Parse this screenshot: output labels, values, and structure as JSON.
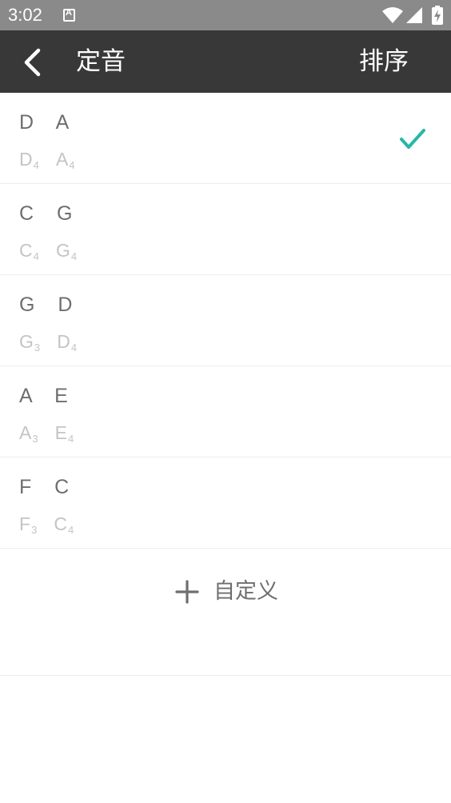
{
  "status_bar": {
    "time": "3:02",
    "icons": [
      "notification-a-icon",
      "wifi-icon",
      "signal-icon",
      "battery-charging-icon"
    ]
  },
  "app_bar": {
    "back_icon": "chevron-left-icon",
    "title": "定音",
    "sort_label": "排序"
  },
  "tunings": [
    {
      "name": "D  A",
      "notes": [
        {
          "note": "D",
          "octave": "4"
        },
        {
          "note": "A",
          "octave": "4"
        }
      ],
      "selected": true
    },
    {
      "name": "C  G",
      "notes": [
        {
          "note": "C",
          "octave": "4"
        },
        {
          "note": "G",
          "octave": "4"
        }
      ],
      "selected": false
    },
    {
      "name": "G  D",
      "notes": [
        {
          "note": "G",
          "octave": "3"
        },
        {
          "note": "D",
          "octave": "4"
        }
      ],
      "selected": false
    },
    {
      "name": "A  E",
      "notes": [
        {
          "note": "A",
          "octave": "3"
        },
        {
          "note": "E",
          "octave": "4"
        }
      ],
      "selected": false
    },
    {
      "name": "F  C",
      "notes": [
        {
          "note": "F",
          "octave": "3"
        },
        {
          "note": "C",
          "octave": "4"
        }
      ],
      "selected": false
    }
  ],
  "add_custom": {
    "icon": "plus-icon",
    "label": "自定义"
  },
  "colors": {
    "status_bar": "#8a8a8a",
    "app_bar": "#383838",
    "check": "#26b7a8",
    "primary_text": "#6e6e6e",
    "secondary_text": "#c4c4c4"
  }
}
